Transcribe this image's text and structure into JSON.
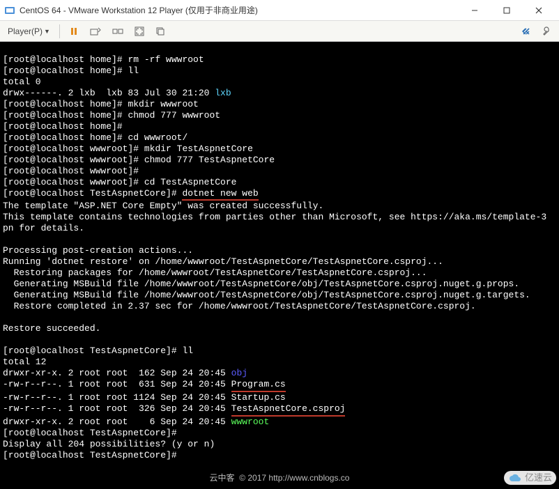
{
  "window": {
    "title": "CentOS 64 - VMware Workstation 12 Player (仅用于非商业用途)"
  },
  "toolbar": {
    "player_label": "Player(P)"
  },
  "term": {
    "l01a": "[root@localhost home]# ",
    "l01b": "rm -rf wwwroot",
    "l02a": "[root@localhost home]# ",
    "l02b": "ll",
    "l03": "total 0",
    "l04a": "drwx------. 2 lxb  lxb 83 Jul 30 21:20 ",
    "l04b": "lxb",
    "l05a": "[root@localhost home]# ",
    "l05b": "mkdir wwwroot",
    "l06a": "[root@localhost home]# ",
    "l06b": "chmod 777 wwwroot",
    "l07a": "[root@localhost home]# ",
    "l08a": "[root@localhost home]# ",
    "l08b": "cd wwwroot/",
    "l09a": "[root@localhost wwwroot]# ",
    "l09b": "mkdir TestAspnetCore",
    "l10a": "[root@localhost wwwroot]# ",
    "l10b": "chmod 777 TestAspnetCore",
    "l11a": "[root@localhost wwwroot]# ",
    "l12a": "[root@localhost wwwroot]# ",
    "l12b": "cd TestAspnetCore",
    "l13a": "[root@localhost TestAspnetCore]# ",
    "l13b": "dotnet new web",
    "l14": "The template \"ASP.NET Core Empty\" was created successfully.",
    "l15": "This template contains technologies from parties other than Microsoft, see https://aka.ms/template-3",
    "l16": "pn for details.",
    "l18": "Processing post-creation actions...",
    "l19": "Running 'dotnet restore' on /home/wwwroot/TestAspnetCore/TestAspnetCore.csproj...",
    "l20": "  Restoring packages for /home/wwwroot/TestAspnetCore/TestAspnetCore.csproj...",
    "l21": "  Generating MSBuild file /home/wwwroot/TestAspnetCore/obj/TestAspnetCore.csproj.nuget.g.props.",
    "l22": "  Generating MSBuild file /home/wwwroot/TestAspnetCore/obj/TestAspnetCore.csproj.nuget.g.targets.",
    "l23": "  Restore completed in 2.37 sec for /home/wwwroot/TestAspnetCore/TestAspnetCore.csproj.",
    "l25": "Restore succeeded.",
    "l27a": "[root@localhost TestAspnetCore]# ",
    "l27b": "ll",
    "l28": "total 12",
    "l29a": "drwxr-xr-x. 2 root root  162 Sep 24 20:45 ",
    "l29b": "obj",
    "l30a": "-rw-r--r--. 1 root root  631 Sep 24 20:45 ",
    "l30b": "Program.cs",
    "l31": "-rw-r--r--. 1 root root 1124 Sep 24 20:45 Startup.cs",
    "l32a": "-rw-r--r--. 1 root root  326 Sep 24 20:45 ",
    "l32b": "TestAspnetCore.csproj",
    "l33a": "drwxr-xr-x. 2 root root    6 Sep 24 20:45 ",
    "l33b": "wwwroot",
    "l34a": "[root@localhost TestAspnetCore]# ",
    "l35": "Display all 204 possibilities? (y or n)",
    "l36a": "[root@localhost TestAspnetCore]# "
  },
  "watermark": {
    "center": "云中客  © 2017 http://www.cnblogs.co",
    "right": "亿速云"
  }
}
